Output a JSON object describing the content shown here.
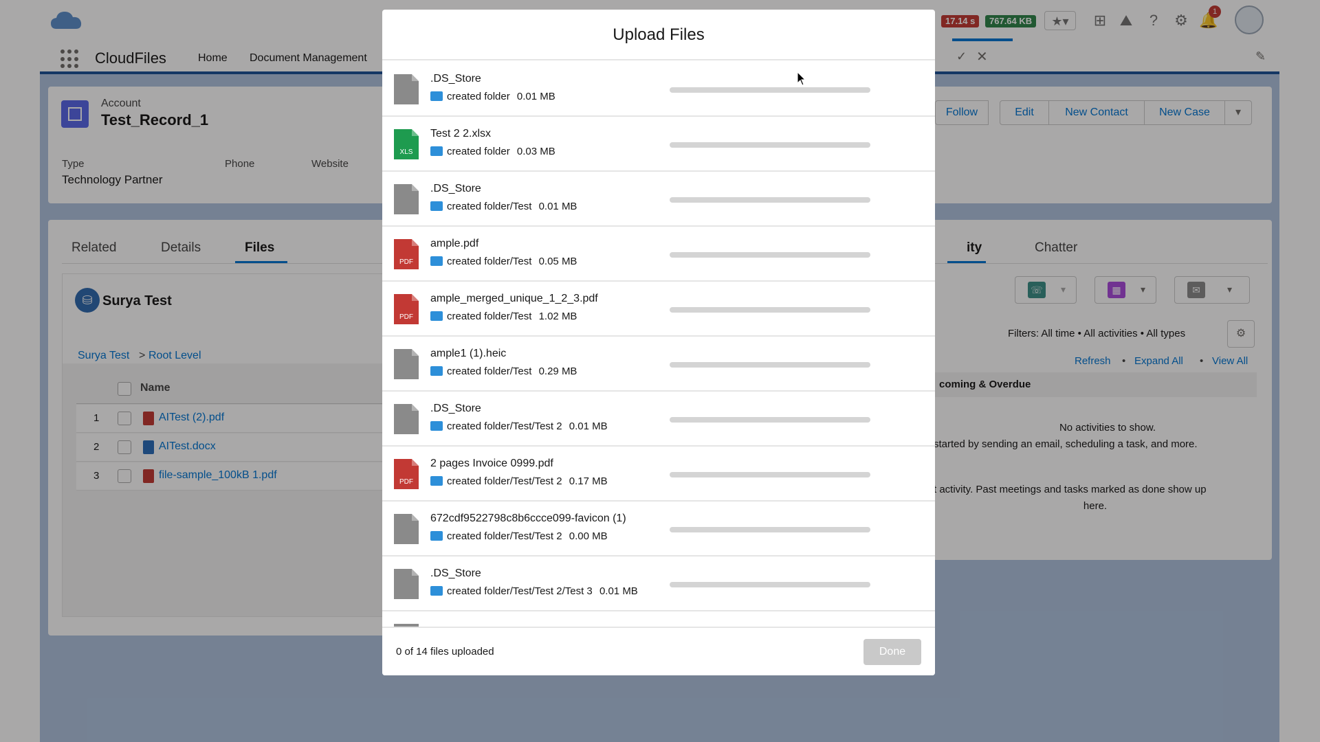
{
  "topbar": {
    "perf_time": "17.14 s",
    "perf_size": "767.64 KB",
    "notif_count": "1"
  },
  "nav": {
    "app_name": "CloudFiles",
    "items": [
      "Home",
      "Document Management"
    ]
  },
  "record": {
    "object_label": "Account",
    "name": "Test_Record_1",
    "fields": [
      {
        "label": "Type",
        "value": "Technology Partner"
      },
      {
        "label": "Phone",
        "value": ""
      },
      {
        "label": "Website",
        "value": ""
      }
    ],
    "actions": [
      "Follow",
      "Edit",
      "New Contact",
      "New Case"
    ]
  },
  "tabs": {
    "left": [
      "Related",
      "Details",
      "Files"
    ],
    "active": "Files",
    "right": [
      "ity",
      "Chatter"
    ]
  },
  "files_panel": {
    "title": "Surya Test",
    "breadcrumb": [
      "Surya Test",
      "Root Level"
    ],
    "column_name": "Name",
    "files": [
      {
        "num": "1",
        "name": "AITest (2).pdf",
        "type": "pdf"
      },
      {
        "num": "2",
        "name": "AITest.docx",
        "type": "docx"
      },
      {
        "num": "3",
        "name": "file-sample_100kB 1.pdf",
        "type": "pdf"
      }
    ]
  },
  "activity": {
    "filters": "Filters: All time • All activities • All types",
    "links": [
      "Refresh",
      "Expand All",
      "View All"
    ],
    "section": "coming & Overdue",
    "empty1": "No activities to show.",
    "empty2": "started by sending an email, scheduling a task, and more.",
    "past1": "t activity. Past meetings and tasks marked as done show up",
    "past2": "here."
  },
  "modal": {
    "title": "Upload Files",
    "rows": [
      {
        "name": ".DS_Store",
        "path": "created folder",
        "size": "0.01 MB",
        "type": "generic",
        "progress": 0
      },
      {
        "name": "Test 2 2.xlsx",
        "path": "created folder",
        "size": "0.03 MB",
        "type": "xls",
        "progress": 0
      },
      {
        "name": ".DS_Store",
        "path": "created folder/Test",
        "size": "0.01 MB",
        "type": "generic",
        "progress": 0
      },
      {
        "name": "ample.pdf",
        "path": "created folder/Test",
        "size": "0.05 MB",
        "type": "pdf",
        "progress": 0
      },
      {
        "name": "ample_merged_unique_1_2_3.pdf",
        "path": "created folder/Test",
        "size": "1.02 MB",
        "type": "pdf",
        "progress": 0
      },
      {
        "name": "ample1 (1).heic",
        "path": "created folder/Test",
        "size": "0.29 MB",
        "type": "generic",
        "progress": 0
      },
      {
        "name": ".DS_Store",
        "path": "created folder/Test/Test 2",
        "size": "0.01 MB",
        "type": "generic",
        "progress": 0
      },
      {
        "name": "2 pages Invoice 0999.pdf",
        "path": "created folder/Test/Test 2",
        "size": "0.17 MB",
        "type": "pdf",
        "progress": 0
      },
      {
        "name": "672cdf9522798c8b6ccce099-favicon (1)",
        "path": "created folder/Test/Test 2",
        "size": "0.00 MB",
        "type": "generic",
        "progress": 0
      },
      {
        "name": ".DS_Store",
        "path": "created folder/Test/Test 2/Test 3",
        "size": "0.01 MB",
        "type": "generic",
        "progress": 0
      }
    ],
    "status": "0 of 14 files uploaded",
    "done_label": "Done"
  },
  "colors": {
    "brand": "#0176d3",
    "pdf": "#c23934",
    "xls": "#1e9b4f",
    "generic_file": "#8a8a8a",
    "folder": "#2d8fd9"
  }
}
